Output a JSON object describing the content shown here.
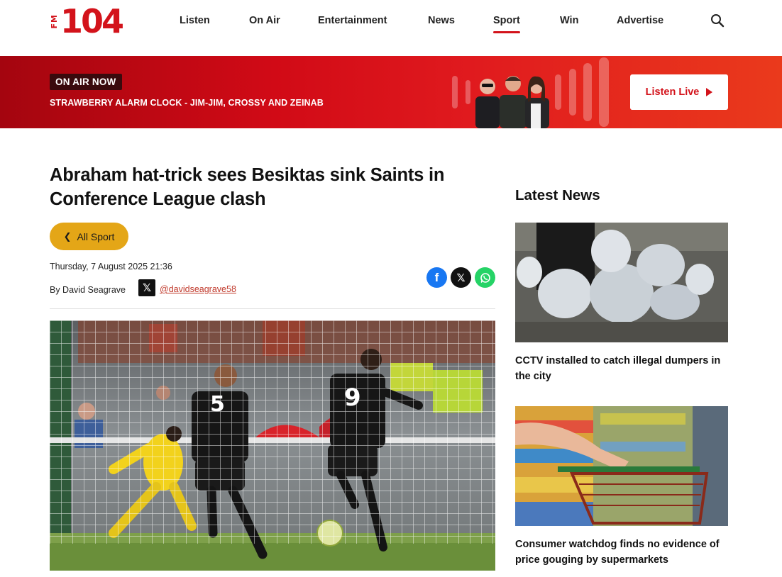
{
  "header": {
    "logo_fm": "FM",
    "logo_num": "104",
    "nav": [
      {
        "label": "Listen",
        "active": false
      },
      {
        "label": "On Air",
        "active": false
      },
      {
        "label": "Entertainment",
        "active": false
      },
      {
        "label": "News",
        "active": false
      },
      {
        "label": "Sport",
        "active": true
      },
      {
        "label": "Win",
        "active": false
      },
      {
        "label": "Advertise",
        "active": false
      }
    ],
    "search_icon": "search-icon"
  },
  "banner": {
    "badge": "ON AIR NOW",
    "show": "STRAWBERRY ALARM CLOCK - JIM-JIM, CROSSY AND ZEINAB",
    "listen_live": "Listen Live"
  },
  "article": {
    "headline": "Abraham hat-trick sees Besiktas sink Saints in Conference League clash",
    "back_label": "All Sport",
    "date": "Thursday, 7 August 2025 21:36",
    "byline": "By David Seagrave",
    "handle": "@davidseagrave58",
    "share": [
      "facebook-icon",
      "x-icon",
      "whatsapp-icon"
    ]
  },
  "sidebar": {
    "title": "Latest News",
    "items": [
      {
        "title": "CCTV installed to catch illegal dumpers in the city"
      },
      {
        "title": "Consumer watchdog finds no evidence of price gouging by supermarkets"
      }
    ]
  },
  "colors": {
    "brand_red": "#d3131b",
    "back_button": "#e4a617",
    "facebook": "#1877f2",
    "whatsapp": "#25d366"
  }
}
